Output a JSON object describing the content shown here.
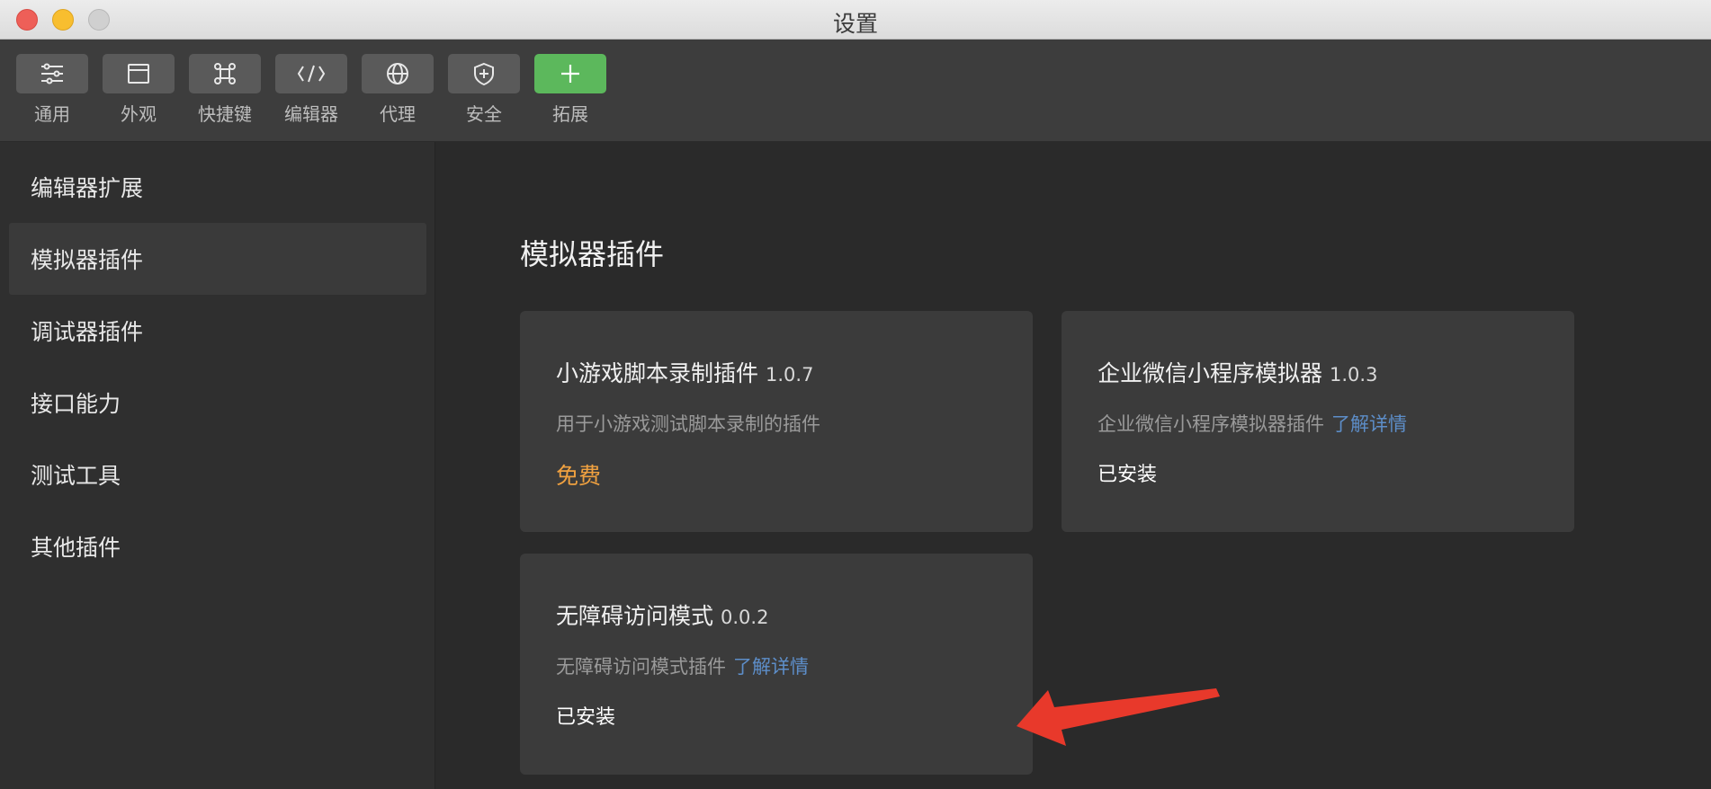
{
  "window": {
    "title": "设置"
  },
  "toolbar": {
    "items": [
      {
        "label": "通用",
        "icon": "sliders-icon"
      },
      {
        "label": "外观",
        "icon": "window-icon"
      },
      {
        "label": "快捷键",
        "icon": "command-icon"
      },
      {
        "label": "编辑器",
        "icon": "code-icon"
      },
      {
        "label": "代理",
        "icon": "globe-icon"
      },
      {
        "label": "安全",
        "icon": "shield-icon"
      },
      {
        "label": "拓展",
        "icon": "plus-icon"
      }
    ]
  },
  "sidebar": {
    "items": [
      {
        "label": "编辑器扩展"
      },
      {
        "label": "模拟器插件",
        "active": true
      },
      {
        "label": "调试器插件"
      },
      {
        "label": "接口能力"
      },
      {
        "label": "测试工具"
      },
      {
        "label": "其他插件"
      }
    ]
  },
  "main": {
    "title": "模拟器插件",
    "plugins": [
      {
        "name": "小游戏脚本录制插件",
        "version": "1.0.7",
        "description": "用于小游戏测试脚本录制的插件",
        "link": "",
        "status": "免费"
      },
      {
        "name": "企业微信小程序模拟器",
        "version": "1.0.3",
        "description": "企业微信小程序模拟器插件",
        "link": "了解详情",
        "status": "已安装"
      },
      {
        "name": "无障碍访问模式",
        "version": "0.0.2",
        "description": "无障碍访问模式插件",
        "link": "了解详情",
        "status": "已安装"
      }
    ]
  },
  "colors": {
    "accent_green": "#5cb85c",
    "free_orange": "#f0a140",
    "link_blue": "#5d8ec9",
    "annotation_red": "#e8392b"
  }
}
